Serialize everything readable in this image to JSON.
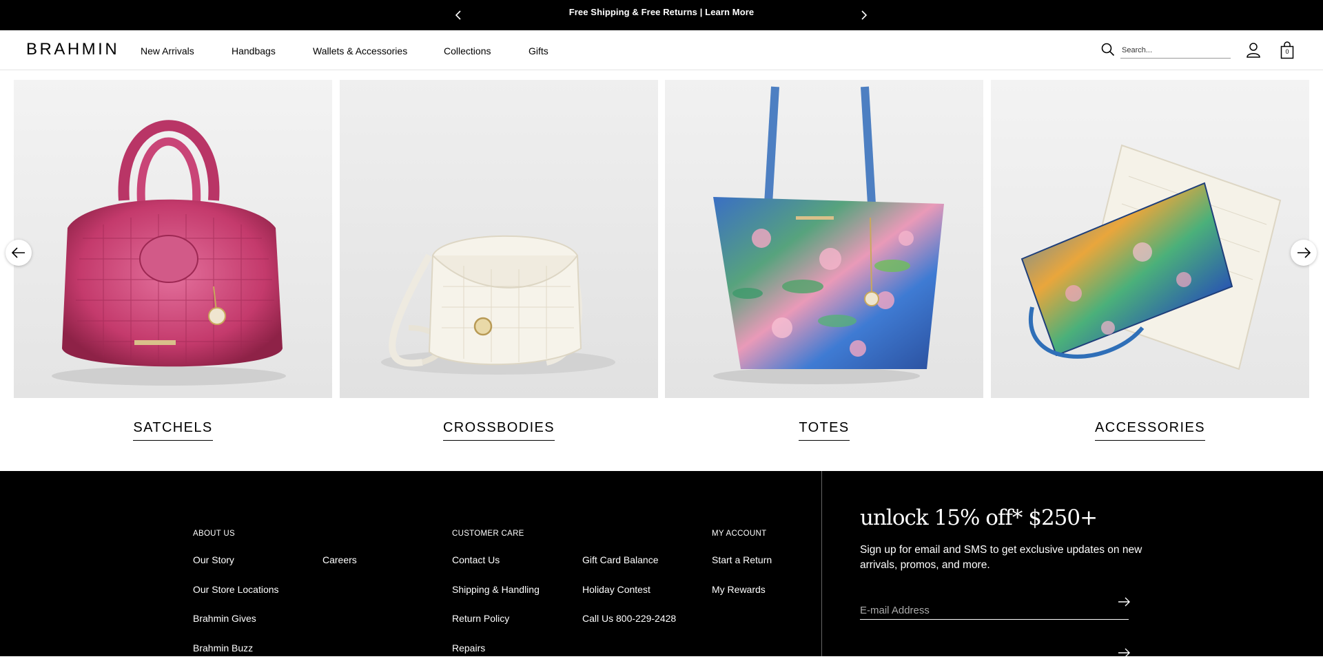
{
  "announcement": {
    "text": "Free Shipping & Free Returns | Learn More"
  },
  "header": {
    "logo": "BRAHMIN",
    "nav": [
      "New Arrivals",
      "Handbags",
      "Wallets & Accessories",
      "Collections",
      "Gifts"
    ],
    "search_placeholder": "Search...",
    "bag_count": "0"
  },
  "categories": [
    {
      "label": "SATCHELS",
      "image": "pink croc satchel handbag"
    },
    {
      "label": "CROSSBODIES",
      "image": "white croc crossbody bag"
    },
    {
      "label": "TOTES",
      "image": "painted water-lily croc tote bag"
    },
    {
      "label": "ACCESSORIES",
      "image": "colorful wristlet wallet on white clutch"
    }
  ],
  "footer": {
    "about": {
      "heading": "ABOUT US",
      "links": [
        "Our Story",
        "Careers",
        "Our Store Locations",
        "Brahmin Gives",
        "Brahmin Buzz"
      ]
    },
    "care": {
      "heading": "CUSTOMER CARE",
      "links": [
        "Contact Us",
        "Gift Card Balance",
        "Shipping & Handling",
        "Holiday Contest",
        "Return Policy",
        "Call Us 800-229-2428",
        "Repairs"
      ]
    },
    "account": {
      "heading": "MY ACCOUNT",
      "links": [
        "Start a Return",
        "My Rewards"
      ]
    },
    "promo": {
      "title": "unlock 15% off* $250+",
      "text": "Sign up for email and SMS to get exclusive updates on new arrivals, promos, and more.",
      "email_placeholder": "E-mail Address"
    }
  },
  "colors": {
    "footer_bg": "#000000",
    "announce_bg": "#000000"
  }
}
